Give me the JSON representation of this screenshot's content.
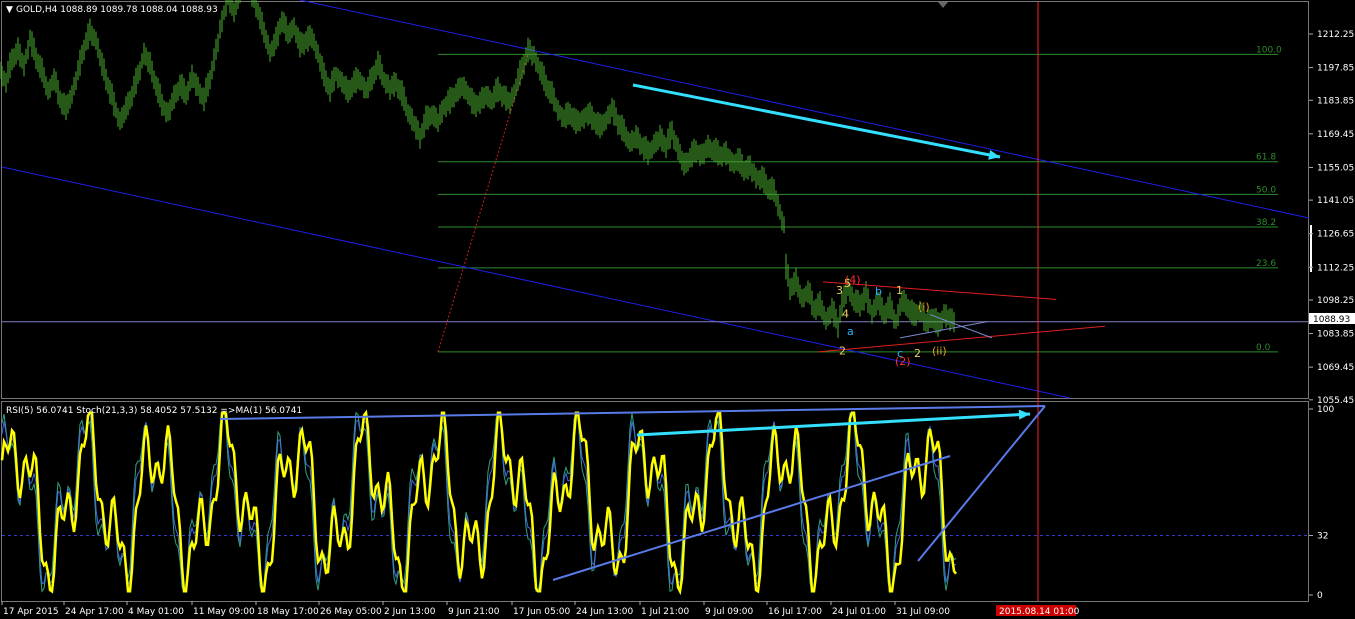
{
  "window": {
    "menu_glyph": "▼",
    "main_title": "GOLD,H4  1088.89 1089.78 1088.04 1088.93",
    "indicator_title": "RSI(5) 56.0741  Stoch(21,3,3) 58.4052 57.5132  =>MA(1) 56.0741",
    "current_price_label": "1088.93",
    "vline_time_label": "2015.08.14 01:00"
  },
  "chart_data": [
    {
      "type": "line",
      "name": "main-price-chart",
      "title": "GOLD,H4  1088.89 1089.78 1088.04 1088.93",
      "symbol": "GOLD",
      "timeframe": "H4",
      "ohlc_last": {
        "open": 1088.89,
        "high": 1089.78,
        "low": 1088.04,
        "close": 1088.93
      },
      "ylim": [
        1050,
        1225
      ],
      "y_ticks": [
        "1212.25",
        "1197.85",
        "1183.85",
        "1169.45",
        "1155.05",
        "1141.05",
        "1126.65",
        "1112.25",
        "1098.25",
        "1083.85",
        "1069.45",
        "1055.45"
      ],
      "x_ticks": [
        "17 Apr 2015",
        "24 Apr 17:00",
        "4 May 01:00",
        "11 May 09:00",
        "18 May 17:00",
        "26 May 05:00",
        "2 Jun 13:00",
        "9 Jun 21:00",
        "17 Jun 05:00",
        "24 Jun 13:00",
        "1 Jul 21:00",
        "9 Jul 09:00",
        "16 Jul 17:00",
        "24 Jul 01:00",
        "31 Jul 09:00"
      ],
      "current_price": 1088.93,
      "price_path": [
        [
          0,
          1196
        ],
        [
          6,
          1192
        ],
        [
          12,
          1201
        ],
        [
          18,
          1205
        ],
        [
          24,
          1199
        ],
        [
          30,
          1210
        ],
        [
          36,
          1202
        ],
        [
          42,
          1196
        ],
        [
          48,
          1188
        ],
        [
          54,
          1193
        ],
        [
          60,
          1184
        ],
        [
          66,
          1180
        ],
        [
          72,
          1187
        ],
        [
          78,
          1196
        ],
        [
          84,
          1206
        ],
        [
          90,
          1213
        ],
        [
          96,
          1210
        ],
        [
          102,
          1199
        ],
        [
          108,
          1190
        ],
        [
          114,
          1182
        ],
        [
          120,
          1175
        ],
        [
          126,
          1180
        ],
        [
          132,
          1186
        ],
        [
          138,
          1194
        ],
        [
          144,
          1204
        ],
        [
          150,
          1199
        ],
        [
          156,
          1190
        ],
        [
          162,
          1182
        ],
        [
          168,
          1178
        ],
        [
          174,
          1185
        ],
        [
          180,
          1190
        ],
        [
          186,
          1186
        ],
        [
          192,
          1194
        ],
        [
          198,
          1189
        ],
        [
          204,
          1184
        ],
        [
          210,
          1193
        ],
        [
          216,
          1205
        ],
        [
          222,
          1218
        ],
        [
          228,
          1228
        ],
        [
          234,
          1222
        ],
        [
          240,
          1230
        ],
        [
          246,
          1235
        ],
        [
          252,
          1229
        ],
        [
          258,
          1222
        ],
        [
          264,
          1213
        ],
        [
          270,
          1205
        ],
        [
          276,
          1209
        ],
        [
          282,
          1218
        ],
        [
          288,
          1212
        ],
        [
          294,
          1216
        ],
        [
          300,
          1207
        ],
        [
          306,
          1209
        ],
        [
          312,
          1211
        ],
        [
          318,
          1204
        ],
        [
          324,
          1194
        ],
        [
          330,
          1188
        ],
        [
          336,
          1195
        ],
        [
          342,
          1192
        ],
        [
          348,
          1187
        ],
        [
          354,
          1191
        ],
        [
          360,
          1193
        ],
        [
          366,
          1188
        ],
        [
          372,
          1193
        ],
        [
          378,
          1199
        ],
        [
          384,
          1193
        ],
        [
          390,
          1189
        ],
        [
          396,
          1191
        ],
        [
          402,
          1186
        ],
        [
          408,
          1179
        ],
        [
          414,
          1174
        ],
        [
          420,
          1168
        ],
        [
          426,
          1175
        ],
        [
          432,
          1178
        ],
        [
          438,
          1175
        ],
        [
          444,
          1181
        ],
        [
          450,
          1183
        ],
        [
          456,
          1187
        ],
        [
          462,
          1190
        ],
        [
          468,
          1187
        ],
        [
          474,
          1181
        ],
        [
          480,
          1183
        ],
        [
          486,
          1186
        ],
        [
          492,
          1184
        ],
        [
          498,
          1188
        ],
        [
          504,
          1185
        ],
        [
          510,
          1183
        ],
        [
          516,
          1190
        ],
        [
          522,
          1197
        ],
        [
          528,
          1205
        ],
        [
          534,
          1203
        ],
        [
          540,
          1197
        ],
        [
          546,
          1190
        ],
        [
          552,
          1186
        ],
        [
          558,
          1180
        ],
        [
          564,
          1176
        ],
        [
          570,
          1178
        ],
        [
          576,
          1174
        ],
        [
          582,
          1176
        ],
        [
          588,
          1178
        ],
        [
          594,
          1175
        ],
        [
          600,
          1172
        ],
        [
          606,
          1176
        ],
        [
          612,
          1180
        ],
        [
          618,
          1174
        ],
        [
          624,
          1170
        ],
        [
          630,
          1166
        ],
        [
          636,
          1168
        ],
        [
          642,
          1164
        ],
        [
          648,
          1161
        ],
        [
          654,
          1165
        ],
        [
          660,
          1168
        ],
        [
          666,
          1164
        ],
        [
          672,
          1170
        ],
        [
          678,
          1163
        ],
        [
          684,
          1156
        ],
        [
          690,
          1159
        ],
        [
          696,
          1162
        ],
        [
          702,
          1160
        ],
        [
          708,
          1164
        ],
        [
          714,
          1162
        ],
        [
          720,
          1160
        ],
        [
          726,
          1161
        ],
        [
          732,
          1157
        ],
        [
          738,
          1158
        ],
        [
          744,
          1154
        ],
        [
          750,
          1155
        ],
        [
          756,
          1151
        ],
        [
          762,
          1150
        ],
        [
          768,
          1146
        ],
        [
          774,
          1145
        ],
        [
          780,
          1136
        ],
        [
          784,
          1130
        ],
        [
          786,
          1112
        ],
        [
          790,
          1103
        ],
        [
          796,
          1106
        ],
        [
          802,
          1099
        ],
        [
          808,
          1102
        ],
        [
          814,
          1094
        ],
        [
          820,
          1096
        ],
        [
          826,
          1090
        ],
        [
          832,
          1094
        ],
        [
          838,
          1087
        ],
        [
          842,
          1096
        ],
        [
          848,
          1104
        ],
        [
          854,
          1098
        ],
        [
          860,
          1096
        ],
        [
          866,
          1100
        ],
        [
          872,
          1093
        ],
        [
          878,
          1098
        ],
        [
          884,
          1092
        ],
        [
          890,
          1095
        ],
        [
          896,
          1089
        ],
        [
          902,
          1098
        ],
        [
          908,
          1095
        ],
        [
          914,
          1091
        ],
        [
          920,
          1094
        ],
        [
          926,
          1088
        ],
        [
          932,
          1091
        ],
        [
          938,
          1087
        ],
        [
          944,
          1092
        ],
        [
          950,
          1090
        ],
        [
          956,
          1089
        ]
      ],
      "fibonacci": {
        "levels": [
          "100.0",
          "61.8",
          "50.0",
          "38.2",
          "23.6",
          "0.0"
        ],
        "prices": [
          1203.5,
          1157.5,
          1143.5,
          1129.5,
          1112.0,
          1076.0
        ]
      },
      "wave_labels": [
        {
          "text": "3",
          "time": 840,
          "price": 1102.5,
          "color": "#e8d060"
        },
        {
          "text": "5",
          "time": 848,
          "price": 1105.5,
          "color": "#e8d060"
        },
        {
          "text": "(4)",
          "time": 849,
          "price": 1107.0,
          "color": "#ff3030"
        },
        {
          "text": "4",
          "time": 846,
          "price": 1092.5,
          "color": "#e8d060"
        },
        {
          "text": "a",
          "time": 851,
          "price": 1085.0,
          "color": "#2fb0ff"
        },
        {
          "text": "2",
          "time": 843,
          "price": 1076.5,
          "color": "#e8d060"
        },
        {
          "text": "b",
          "time": 879,
          "price": 1102.0,
          "color": "#2fb0ff"
        },
        {
          "text": "1",
          "time": 900,
          "price": 1102.5,
          "color": "#e8d060"
        },
        {
          "text": "(i)",
          "time": 922,
          "price": 1095.5,
          "color": "#e8a020"
        },
        {
          "text": "c",
          "time": 901,
          "price": 1075.5,
          "color": "#2fb0ff"
        },
        {
          "text": "2",
          "time": 918,
          "price": 1075.5,
          "color": "#e8d060"
        },
        {
          "text": "(ii)",
          "time": 936,
          "price": 1076.5,
          "color": "#e8a020"
        },
        {
          "text": "(2)",
          "time": 899,
          "price": 1072.0,
          "color": "#ff3030"
        }
      ],
      "annotations": [
        "blue descending channel",
        "red converging triangle",
        "cyan arrow toward channel top",
        "red vertical time line at 2015.08.14 01:00"
      ]
    },
    {
      "type": "line",
      "name": "rsi-stochastic-indicator",
      "title": "RSI(5) 56.0741  Stoch(21,3,3) 58.4052 57.5132  =>MA(1) 56.0741",
      "ylim": [
        0,
        100
      ],
      "y_ticks": [
        "100",
        "32",
        "0"
      ],
      "level_line": 32,
      "series": [
        {
          "name": "RSI(5)",
          "color": "#ffff00",
          "last": 56.0741
        },
        {
          "name": "Stoch(21,3,3)",
          "color": "#4169e1",
          "values_last": [
            58.4052,
            57.5132
          ]
        },
        {
          "name": "MA(1)",
          "color": "#30c0a0",
          "last": 56.0741
        }
      ],
      "annotations": [
        "blue trendlines converging near the red time line",
        "cyan rising arrow"
      ]
    }
  ],
  "colors": {
    "background": "#000000",
    "candles": "#4caf2e",
    "channel": "#1e1ee6",
    "fib": "#2e8b2e",
    "arrow": "#33e0ff",
    "vline": "#ff2020",
    "rsi": "#ffff00",
    "stoch": "#4169e1",
    "price_tag_bg": "#ffffff",
    "time_tag_bg": "#cc0000"
  }
}
